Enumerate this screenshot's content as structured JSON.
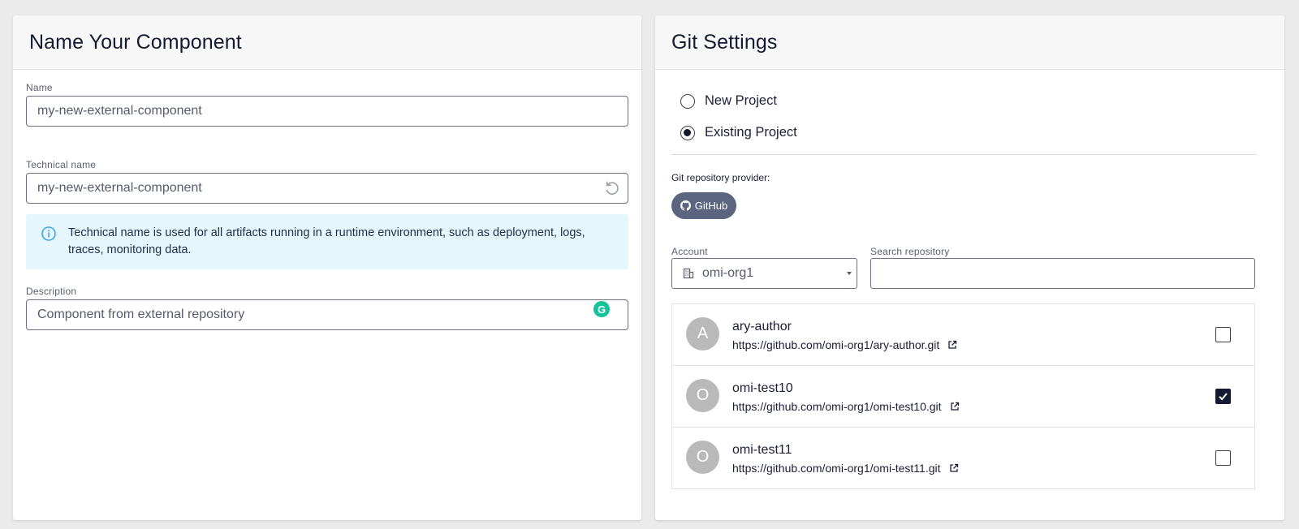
{
  "left_panel": {
    "title": "Name Your Component",
    "name_label": "Name",
    "name_value": "my-new-external-component",
    "technical_name_label": "Technical name",
    "technical_name_value": "my-new-external-component",
    "info_text": "Technical name is used for all artifacts running in a runtime environment, such as deployment, logs, traces, monitoring data.",
    "description_label": "Description",
    "description_value": "Component from external repository"
  },
  "right_panel": {
    "title": "Git Settings",
    "radio_options": [
      {
        "label": "New Project",
        "checked": false
      },
      {
        "label": "Existing Project",
        "checked": true
      }
    ],
    "provider_label": "Git repository provider:",
    "provider_button": "GitHub",
    "account_label": "Account",
    "account_value": "omi-org1",
    "search_label": "Search repository",
    "search_value": "",
    "repos": [
      {
        "initial": "A",
        "name": "ary-author",
        "url": "https://github.com/omi-org1/ary-author.git",
        "checked": false
      },
      {
        "initial": "O",
        "name": "omi-test10",
        "url": "https://github.com/omi-org1/omi-test10.git",
        "checked": true
      },
      {
        "initial": "O",
        "name": "omi-test11",
        "url": "https://github.com/omi-org1/omi-test11.git",
        "checked": false
      }
    ]
  },
  "colors": {
    "info_background": "#e6f6fd",
    "info_icon": "#3aa5e8",
    "github_button": "#5c6580",
    "grammarly": "#15c39a",
    "avatar": "#b9b9b9"
  }
}
